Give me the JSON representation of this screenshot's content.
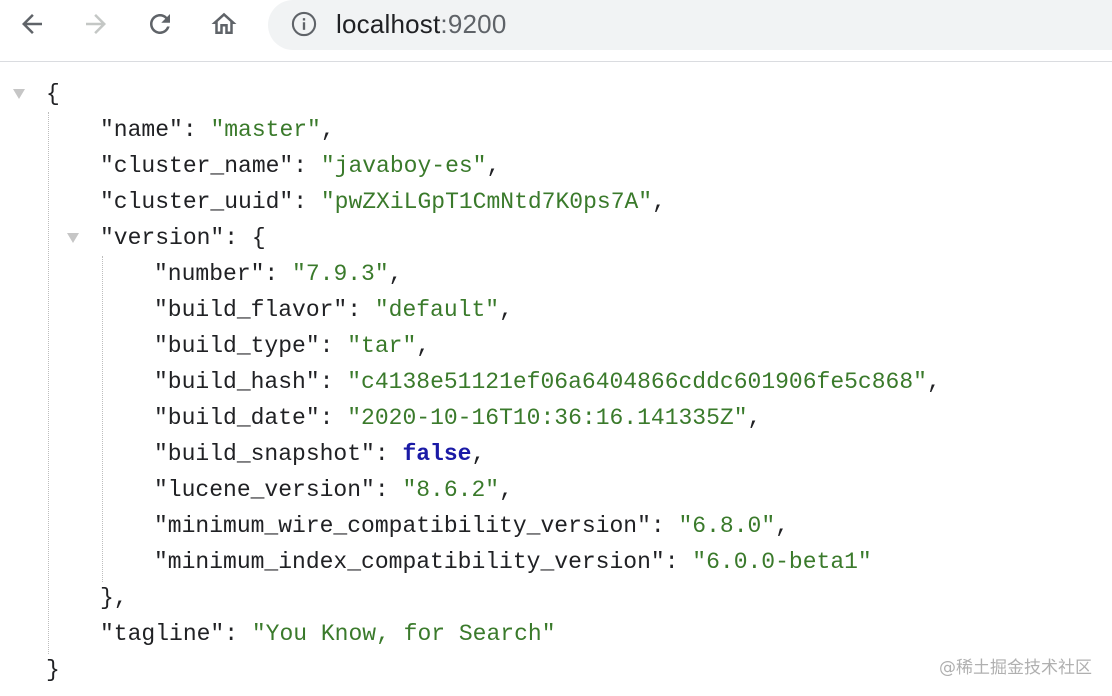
{
  "browser": {
    "url_host": "localhost",
    "url_port": ":9200",
    "icons": {
      "back": "arrow-left-icon",
      "forward": "arrow-right-icon",
      "reload": "reload-icon",
      "home": "home-icon",
      "site_info": "info-icon"
    }
  },
  "json_view": {
    "open_root": "{",
    "close_root": "}",
    "name_key": "\"name\"",
    "name_value": "\"master\"",
    "cluster_name_key": "\"cluster_name\"",
    "cluster_name_value": "\"javaboy-es\"",
    "cluster_uuid_key": "\"cluster_uuid\"",
    "cluster_uuid_value": "\"pwZXiLGpT1CmNtd7K0ps7A\"",
    "version_key": "\"version\"",
    "version_open": "{",
    "version_close": "},",
    "number_key": "\"number\"",
    "number_value": "\"7.9.3\"",
    "build_flavor_key": "\"build_flavor\"",
    "build_flavor_value": "\"default\"",
    "build_type_key": "\"build_type\"",
    "build_type_value": "\"tar\"",
    "build_hash_key": "\"build_hash\"",
    "build_hash_value": "\"c4138e51121ef06a6404866cddc601906fe5c868\"",
    "build_date_key": "\"build_date\"",
    "build_date_value": "\"2020-10-16T10:36:16.141335Z\"",
    "build_snapshot_key": "\"build_snapshot\"",
    "build_snapshot_value": "false",
    "lucene_version_key": "\"lucene_version\"",
    "lucene_version_value": "\"8.6.2\"",
    "min_wire_key": "\"minimum_wire_compatibility_version\"",
    "min_wire_value": "\"6.8.0\"",
    "min_index_key": "\"minimum_index_compatibility_version\"",
    "min_index_value": "\"6.0.0-beta1\"",
    "tagline_key": "\"tagline\"",
    "tagline_value": "\"You Know, for Search\""
  },
  "colors": {
    "string": "#3a7a2b",
    "boolean": "#1a1aa6",
    "key": "#202124"
  },
  "watermark": "@稀土掘金技术社区"
}
